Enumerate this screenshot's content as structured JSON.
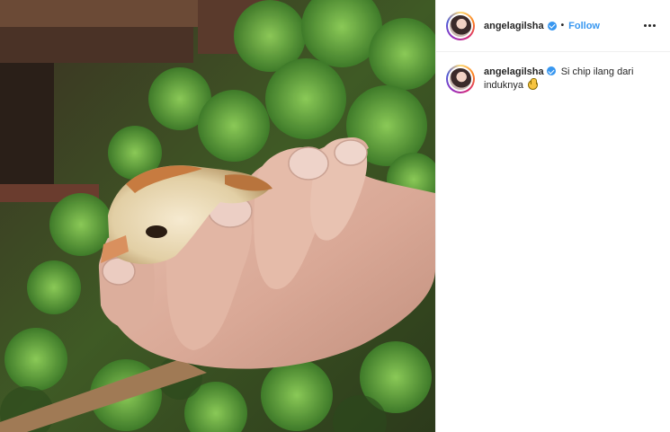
{
  "media": {
    "alt_subject": "",
    "icon": "photo-chick-in-hand"
  },
  "header": {
    "username": "angelagilsha",
    "separator": "•",
    "follow_label": "Follow",
    "more_icon": "ellipsis-icon"
  },
  "caption": {
    "username": "angelagilsha",
    "text": "Si chip ilang dari induknya",
    "emoji": "😱"
  },
  "colors": {
    "link": "#3897f0",
    "verified": "#3897f0",
    "text": "#262626",
    "divider": "#efefef"
  }
}
